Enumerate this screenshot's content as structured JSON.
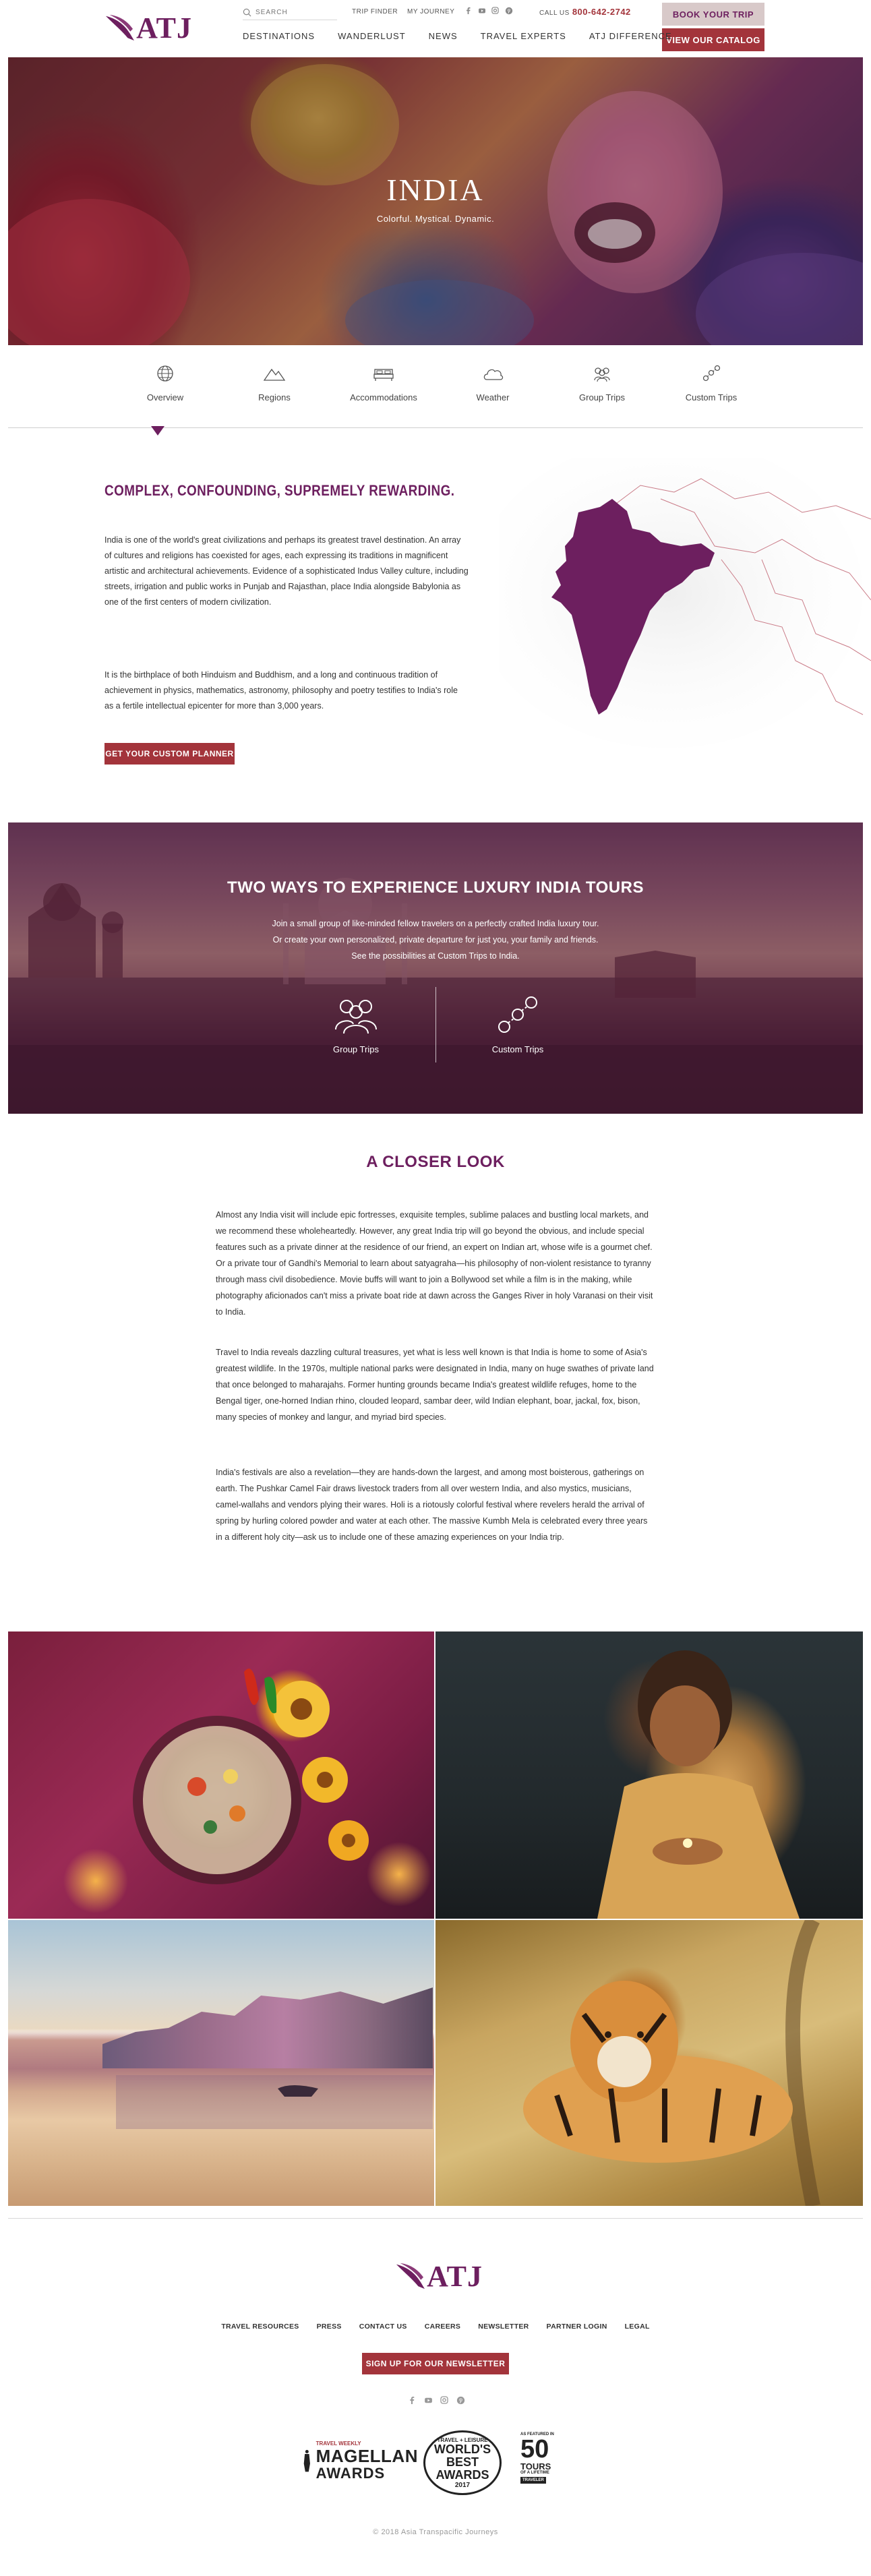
{
  "header": {
    "logo_text": "ATJ",
    "search_placeholder": "SEARCH",
    "trip_finder": "TRIP FINDER",
    "my_journey": "MY JOURNEY",
    "call_label": "CALL US",
    "phone": "800-642-2742",
    "book_button": "BOOK YOUR TRIP",
    "catalog_button": "VIEW OUR CATALOG",
    "nav": [
      "DESTINATIONS",
      "WANDERLUST",
      "NEWS",
      "TRAVEL EXPERTS",
      "ATJ DIFFERENCE"
    ],
    "social_icons": [
      "facebook-icon",
      "youtube-icon",
      "instagram-icon",
      "pinterest-icon"
    ]
  },
  "hero": {
    "title": "INDIA",
    "subtitle": "Colorful. Mystical. Dynamic."
  },
  "tabs": [
    {
      "label": "Overview",
      "icon": "globe-icon",
      "active": true
    },
    {
      "label": "Regions",
      "icon": "mountain-icon",
      "active": false
    },
    {
      "label": "Accommodations",
      "icon": "bed-icon",
      "active": false
    },
    {
      "label": "Weather",
      "icon": "cloud-icon",
      "active": false
    },
    {
      "label": "Group Trips",
      "icon": "group-icon",
      "active": false
    },
    {
      "label": "Custom Trips",
      "icon": "route-icon",
      "active": false
    }
  ],
  "intro": {
    "heading": "COMPLEX, CONFOUNDING, SUPREMELY REWARDING.",
    "p1": "India is one of the world's great civilizations and perhaps its greatest travel destination. An array of cultures and religions has coexisted for ages, each expressing its traditions in magnificent artistic and architectural achievements. Evidence of a sophisticated Indus Valley culture, including streets, irrigation and public works in Punjab and Rajasthan, place India alongside Babylonia as one of the first centers of modern civilization.",
    "p2": "It is the birthplace of both Hinduism and Buddhism, and a long and continuous tradition of achievement in physics, mathematics, astronomy, philosophy and poetry testifies to India's role as a fertile intellectual epicenter for more than 3,000 years.",
    "button": "GET YOUR CUSTOM PLANNER"
  },
  "two_ways": {
    "heading": "TWO WAYS TO EXPERIENCE LUXURY INDIA TOURS",
    "text": "Join a small group of like-minded fellow travelers on a perfectly crafted India luxury tour. Or create your own personalized, private departure for just you, your family and friends. See the possibilities at Custom Trips to India.",
    "group_label": "Group Trips",
    "custom_label": "Custom Trips"
  },
  "closer": {
    "heading": "A CLOSER LOOK",
    "p1": "Almost any India visit will include epic fortresses, exquisite temples, sublime palaces and bustling local markets, and we recommend these wholeheartedly. However, any great India trip will go beyond the obvious, and include special features such as a private dinner at the residence of our friend, an expert on Indian art, whose wife is a gourmet chef. Or a private tour of Gandhi's Memorial to learn about satyagraha—his philosophy of non-violent resistance to tyranny through mass civil disobedience. Movie buffs will want to join a Bollywood set while a film is in the making, while photography aficionados can't miss a private boat ride at dawn across the Ganges River in holy Varanasi on their visit to India.",
    "p2": "Travel to India reveals dazzling cultural treasures, yet what is less well known is that India is home to some of Asia's greatest wildlife. In the 1970s, multiple national parks were designated in India, many on huge swathes of private land that once belonged to maharajahs. Former hunting grounds became India's greatest wildlife refuges, home to the Bengal tiger, one-horned Indian rhino, clouded leopard, sambar deer, wild Indian elephant, boar, jackal, fox, bison, many species of monkey and langur, and myriad bird species.",
    "p3": "India's festivals are also a revelation—they are hands-down the largest, and among most boisterous, gatherings on earth. The Pushkar Camel Fair draws livestock traders from all over western India, and also mystics, musicians, camel-wallahs and vendors plying their wares. Holi is a riotously colorful festival where revelers herald the arrival of spring by hurling colored powder and water at each other. The massive Kumbh Mela is celebrated every three years in a different holy city—ask us to include one of these amazing experiences on your India trip."
  },
  "footer": {
    "links": [
      "TRAVEL RESOURCES",
      "PRESS",
      "CONTACT US",
      "CAREERS",
      "NEWSLETTER",
      "PARTNER LOGIN",
      "LEGAL"
    ],
    "newsletter_button": "SIGN UP FOR OUR NEWSLETTER",
    "awards": {
      "magellan_small": "TRAVEL WEEKLY",
      "magellan_big": "MAGELLAN",
      "magellan_sub": "AWARDS",
      "wb_top": "TRAVEL + LEISURE",
      "wb_big": "WORLD'S BEST AWARDS",
      "wb_year": "2017",
      "fifty_small": "AS FEATURED IN",
      "fifty_num": "50",
      "fifty_tours": "TOURS",
      "fifty_sub": "OF A LIFETIME",
      "fifty_brand": "TRAVELER"
    },
    "copyright": "© 2018 Asia Transpacific Journeys"
  },
  "colors": {
    "brand_purple": "#6d1f5f",
    "brand_red": "#a3343b",
    "book_bg": "#d8c9c9"
  }
}
